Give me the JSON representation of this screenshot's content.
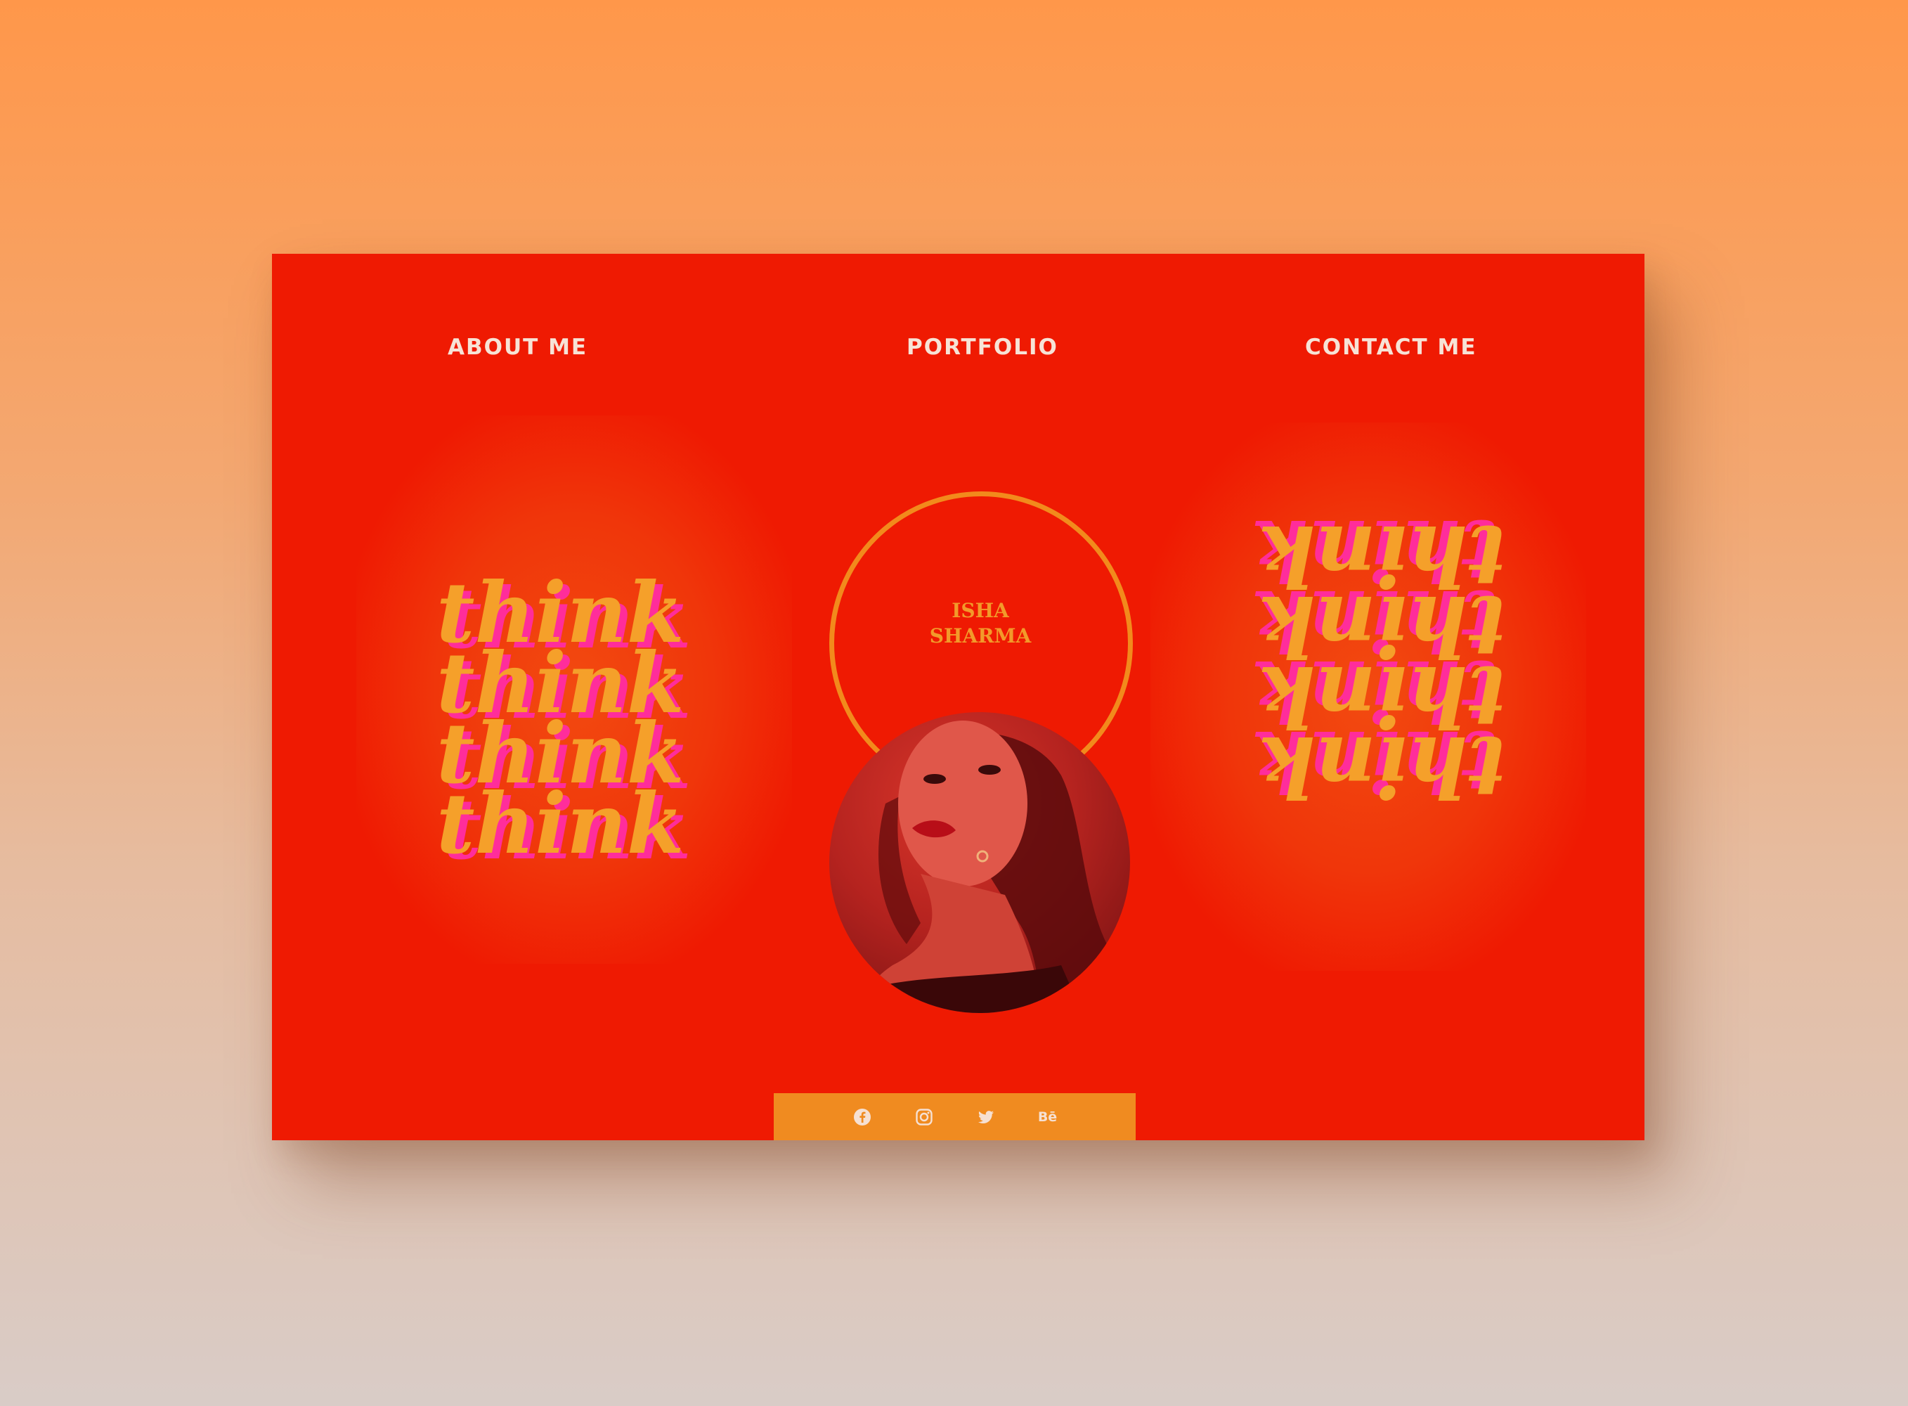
{
  "nav": {
    "about": "ABOUT ME",
    "portfolio": "PORTFOLIO",
    "contact": "CONTACT ME"
  },
  "profile": {
    "first_name": "ISHA",
    "last_name": "SHARMA"
  },
  "artwork": {
    "word": "think",
    "repeat_count": 4
  },
  "social": {
    "items": [
      "facebook-icon",
      "instagram-icon",
      "twitter-icon",
      "behance-icon"
    ],
    "behance_label": "Bē"
  },
  "colors": {
    "background_top": "#ff974a",
    "background_bottom": "#d9ccc7",
    "card": "#ef1a02",
    "accent_orange": "#f28a1c",
    "nav_text": "#f7e3d6",
    "accent_pink": "#ff2d9b"
  }
}
